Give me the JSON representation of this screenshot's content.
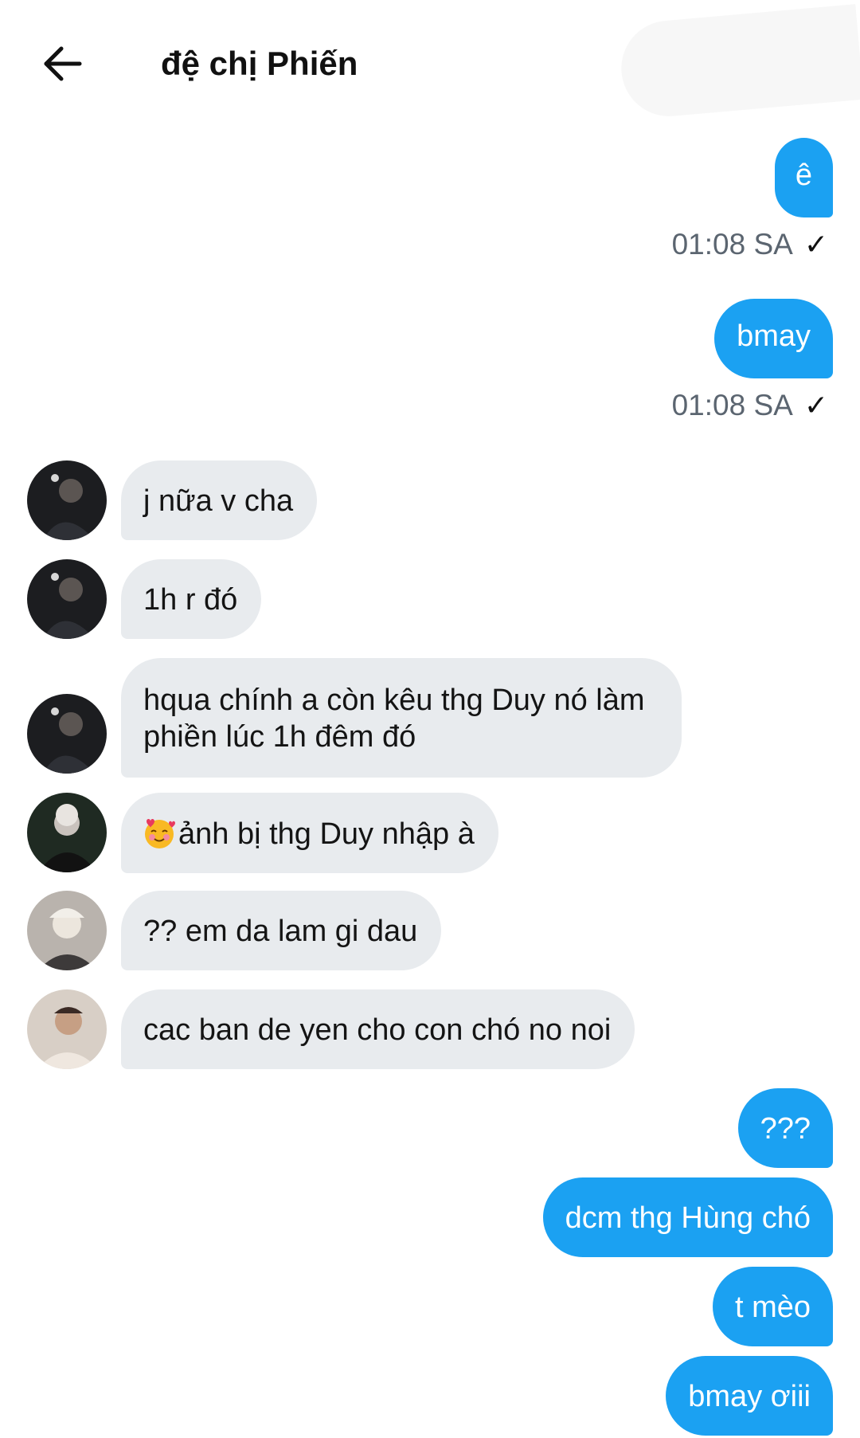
{
  "header": {
    "title": "đệ chị Phiến",
    "back_icon": "arrow-left-icon"
  },
  "messages": [
    {
      "side": "out",
      "text": "ê",
      "timestamp": "01:08 SA",
      "status_icon": "check-icon"
    },
    {
      "side": "out",
      "text": "bmay",
      "timestamp": "01:08 SA",
      "status_icon": "check-icon"
    },
    {
      "side": "in",
      "text": "j nữa v cha",
      "avatar": "avatar-dark-portrait"
    },
    {
      "side": "in",
      "text": "1h r đó",
      "avatar": "avatar-dark-portrait"
    },
    {
      "side": "in",
      "text": "hqua chính a còn kêu thg Duy nó làm",
      "text_line2": "phiền lúc 1h đêm đó",
      "avatar": "avatar-dark-portrait"
    },
    {
      "side": "in",
      "text": "ảnh bị thg Duy nhập à",
      "emoji": "smiling-face-with-hearts-icon",
      "avatar": "avatar-green-portrait"
    },
    {
      "side": "in",
      "text": "?? em da lam gi dau",
      "avatar": "avatar-blonde-portrait"
    },
    {
      "side": "in",
      "text": "cac ban de yen cho con chó no noi",
      "avatar": "avatar-light-portrait"
    },
    {
      "side": "out",
      "text": "???"
    },
    {
      "side": "out",
      "text": "dcm thg Hùng chó"
    },
    {
      "side": "out",
      "text": "t mèo"
    },
    {
      "side": "out",
      "text": "bmay ơiii"
    }
  ],
  "colors": {
    "outgoing_bubble": "#1ba1f2",
    "incoming_bubble": "#e8ebee",
    "timestamp_text": "#5b6570"
  }
}
